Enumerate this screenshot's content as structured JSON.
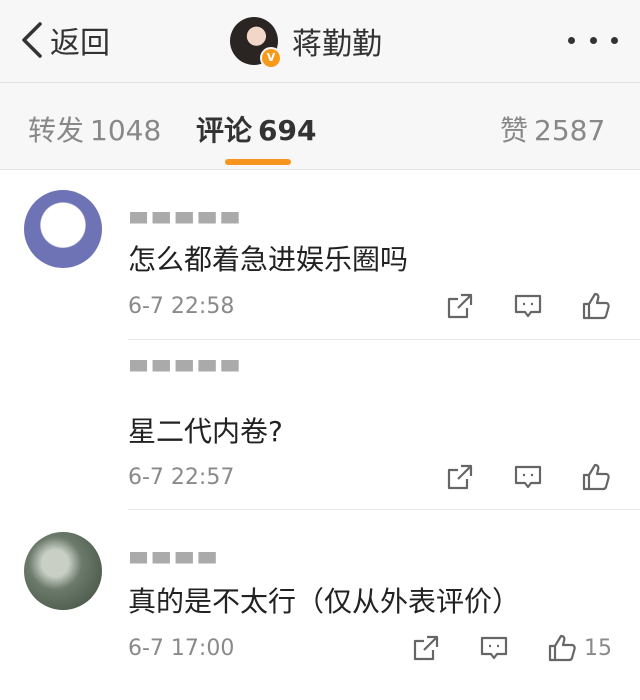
{
  "navbar": {
    "back_label": "返回",
    "profile_name": "蒋勤勤",
    "verified_badge": "V",
    "back_icon": "chevron-left-icon",
    "more_icon": "more-dots-icon"
  },
  "tabs": {
    "repost": {
      "label": "转发",
      "count": "1048"
    },
    "comments": {
      "label": "评论",
      "count": "694"
    },
    "likes": {
      "label": "赞",
      "count": "2587"
    }
  },
  "colors": {
    "accent": "#f7941d",
    "verified": "#f79a1a",
    "text": "#333333",
    "muted": "#888888"
  },
  "comments": [
    {
      "text": "怎么都着急进娱乐圈吗",
      "time": "6-7 22:58",
      "like_count": ""
    },
    {
      "text": "星二代内卷?",
      "time": "6-7 22:57",
      "like_count": ""
    },
    {
      "text": "真的是不太行（仅从外表评价）",
      "time": "6-7 17:00",
      "like_count": "15"
    }
  ],
  "action_icons": [
    "share-icon",
    "comment-icon",
    "thumbs-up-icon"
  ]
}
